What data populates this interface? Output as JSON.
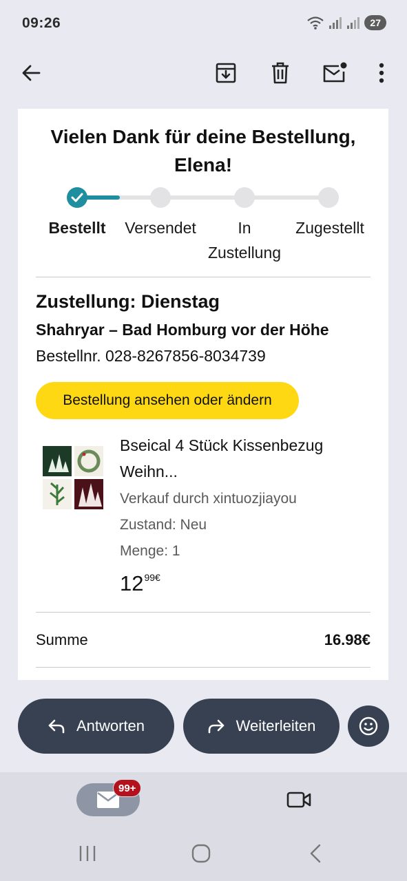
{
  "status_bar": {
    "time": "09:26",
    "battery": "27"
  },
  "app_bar": {
    "back_icon": "arrow-back-icon",
    "archive_icon": "archive-icon",
    "delete_icon": "trash-icon",
    "mark_unread_icon": "mail-unread-icon",
    "more_icon": "more-vert-icon"
  },
  "email": {
    "title_line1": "Vielen Dank für deine Bestellung,",
    "title_line2": "Elena!",
    "steps": [
      {
        "label": "Bestellt",
        "done": true
      },
      {
        "label": "Versendet",
        "done": false
      },
      {
        "label_line1": "In",
        "label_line2": "Zustellung",
        "done": false
      },
      {
        "label": "Zugestellt",
        "done": false
      }
    ],
    "delivery_title": "Zustellung: Dienstag",
    "delivery_address": "Shahryar – Bad Homburg vor der Höhe",
    "order_number": "Bestellnr. 028-8267856-8034739",
    "order_button": "Bestellung ansehen oder ändern",
    "product": {
      "title_line1": "Bseical 4 Stück Kissenbezug",
      "title_line2": "Weihn...",
      "seller": "Verkauf durch xintuozjiayou",
      "condition": "Zustand: Neu",
      "quantity": "Menge: 1",
      "price_main": "12",
      "price_cents": "99€"
    },
    "total_label": "Summe",
    "total_value": "16.98€"
  },
  "actions": {
    "reply": "Antworten",
    "forward": "Weiterleiten",
    "emoji_icon": "emoji-reaction-icon"
  },
  "bottom_nav": {
    "mail_badge": "99+",
    "mail_icon": "mail-icon",
    "meet_icon": "video-icon"
  },
  "colors": {
    "accent": "#1f8fa0",
    "button_yellow": "#ffd814",
    "action_dark": "#374152",
    "badge_red": "#b3121c"
  }
}
